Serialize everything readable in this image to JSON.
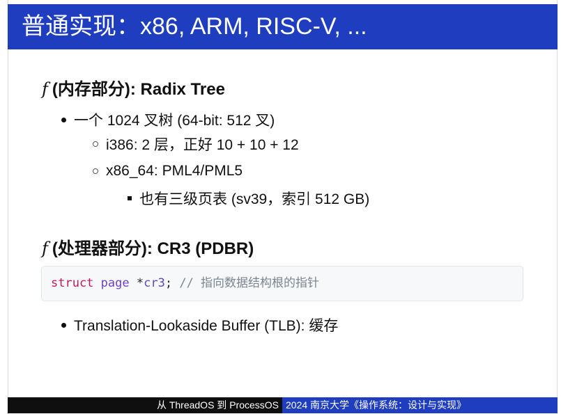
{
  "title": "普通实现：x86, ARM, RISC-V, ...",
  "sections": [
    {
      "fn_symbol": "𝑓",
      "heading": "(内存部分): Radix Tree",
      "bullets": [
        "一个 1024 叉树 (64-bit: 512 叉)",
        "i386: 2 层，正好 10 + 10 + 12",
        "x86_64: PML4/PML5",
        "也有三级页表 (sv39，索引 512 GB)"
      ]
    },
    {
      "fn_symbol": "𝑓",
      "heading": "(处理器部分): CR3 (PDBR)",
      "code": {
        "keyword": "struct",
        "type": "page",
        "star": "*",
        "ident": "cr3",
        "semi": ";",
        "comment": "// 指向数据结构根的指针"
      },
      "bullets": [
        "Translation-Lookaside Buffer (TLB): 缓存"
      ]
    }
  ],
  "footer": {
    "left": "从 ThreadOS 到 ProcessOS",
    "right": "2024 南京大学《操作系统：设计与实现》"
  },
  "colors": {
    "title_bar": "#1f3dbf",
    "footer_left_bg": "#0f0f0f",
    "footer_right_bg": "#1f3dbf",
    "code_bg": "#f6f8fa"
  }
}
